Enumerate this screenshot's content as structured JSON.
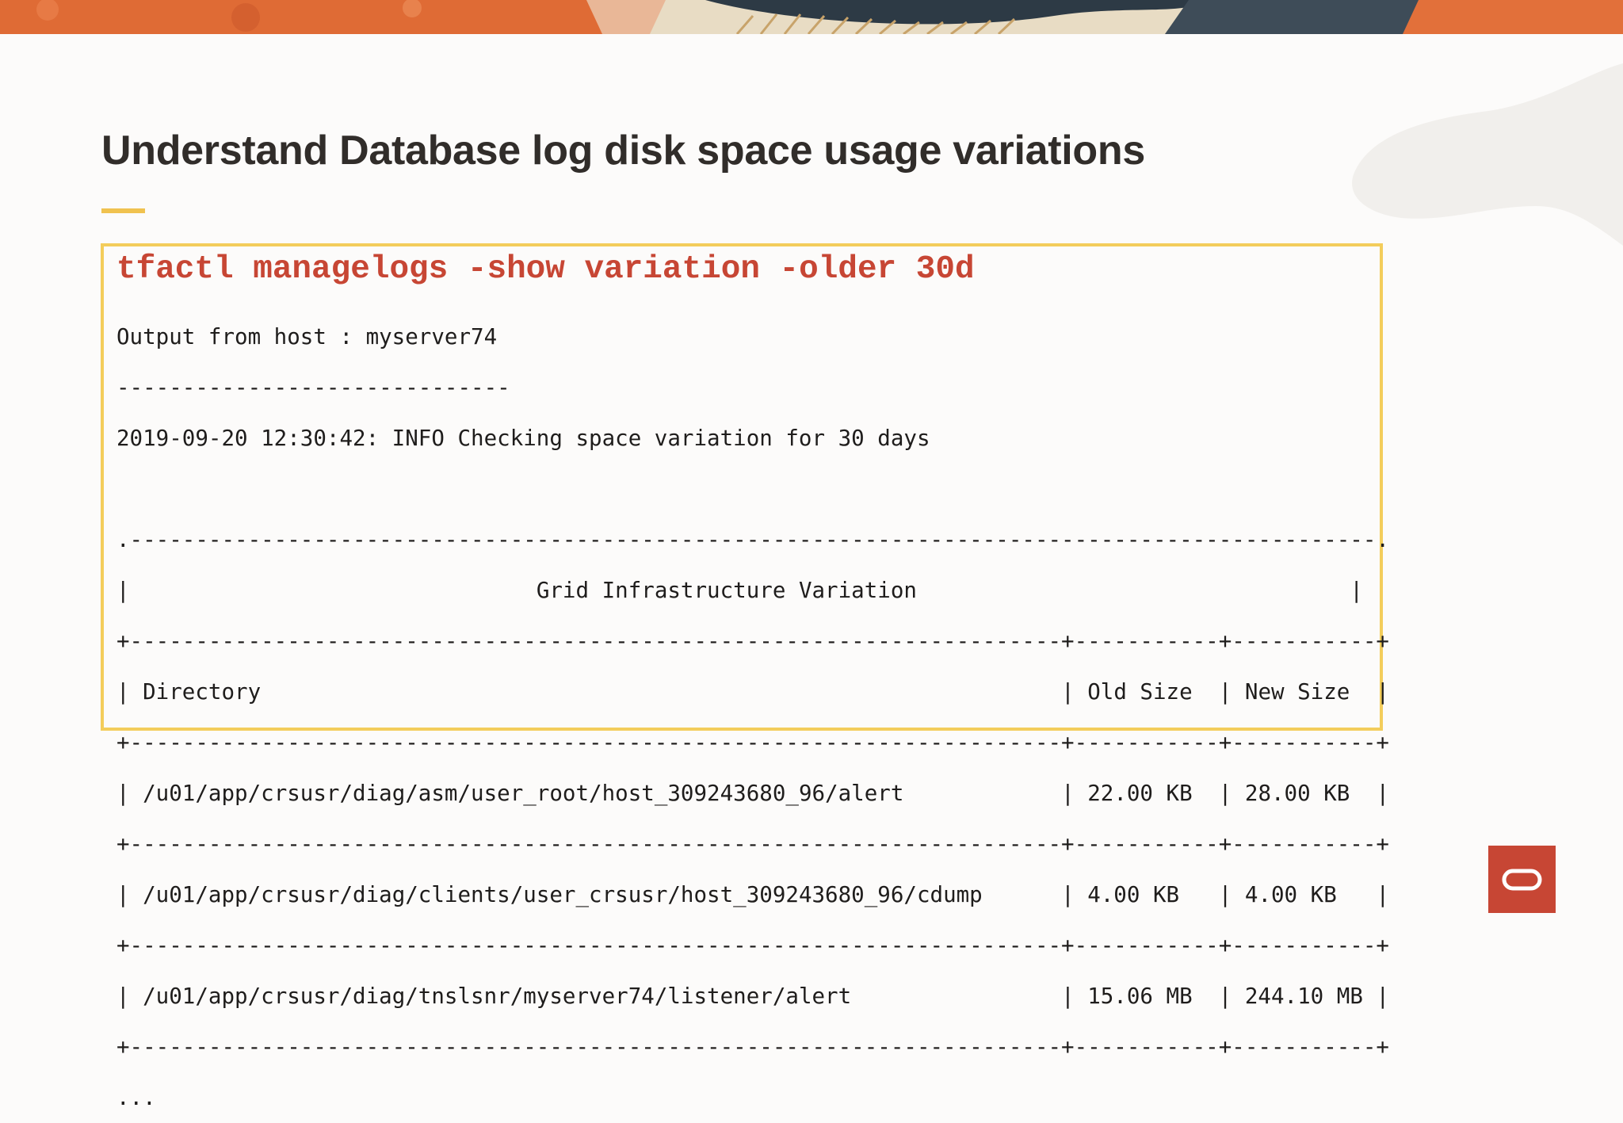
{
  "slide": {
    "title": "Understand Database log disk space usage variations"
  },
  "command": "tfactl managelogs -show variation -older 30d",
  "output": {
    "host_line": "Output from host : myserver74",
    "host_rule": "------------------------------",
    "info_line": "2019-09-20 12:30:42: INFO Checking space variation for 30 days"
  },
  "table": {
    "title": "Grid Infrastructure Variation",
    "columns": [
      "Directory",
      "Old Size",
      "New Size"
    ],
    "rows": [
      [
        "/u01/app/crsusr/diag/asm/user_root/host_309243680_96/alert",
        "22.00 KB",
        "28.00 KB"
      ],
      [
        "/u01/app/crsusr/diag/clients/user_crsusr/host_309243680_96/cdump",
        "4.00 KB",
        "4.00 KB"
      ],
      [
        "/u01/app/crsusr/diag/tnslsnr/myserver74/listener/alert",
        "15.06 MB",
        "244.10 MB"
      ]
    ],
    "continuation": "..."
  },
  "colors": {
    "accent_red": "#c74634",
    "box_border": "#f3cd5b",
    "title_text": "#312d2a"
  },
  "icons": [
    "oracle-logo-icon"
  ]
}
